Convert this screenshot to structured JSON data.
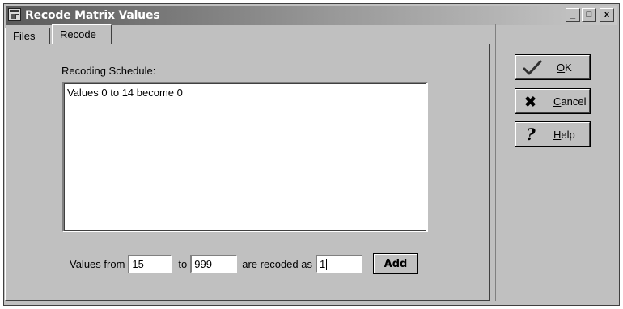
{
  "window": {
    "title": "Recode Matrix Values",
    "controls": {
      "minimize": "_",
      "maximize": "□",
      "close": "x"
    }
  },
  "tabs": [
    {
      "label": "Files",
      "active": false
    },
    {
      "label": "Recode",
      "active": true
    }
  ],
  "recode": {
    "schedule_label": "Recoding Schedule:",
    "schedule_items": [
      "Values 0 to 14 become 0"
    ],
    "values_from_label": "Values from",
    "from_value": "15",
    "to_label": "to",
    "to_value": "999",
    "recoded_as_label": "are recoded as",
    "recoded_value": "1",
    "add_label": "Add"
  },
  "side_buttons": {
    "ok": {
      "mnemonic": "O",
      "rest": "K",
      "icon": "check-icon"
    },
    "cancel": {
      "mnemonic": "C",
      "rest": "ancel",
      "icon": "x-icon"
    },
    "help": {
      "mnemonic": "H",
      "rest": "elp",
      "icon": "question-icon"
    }
  }
}
